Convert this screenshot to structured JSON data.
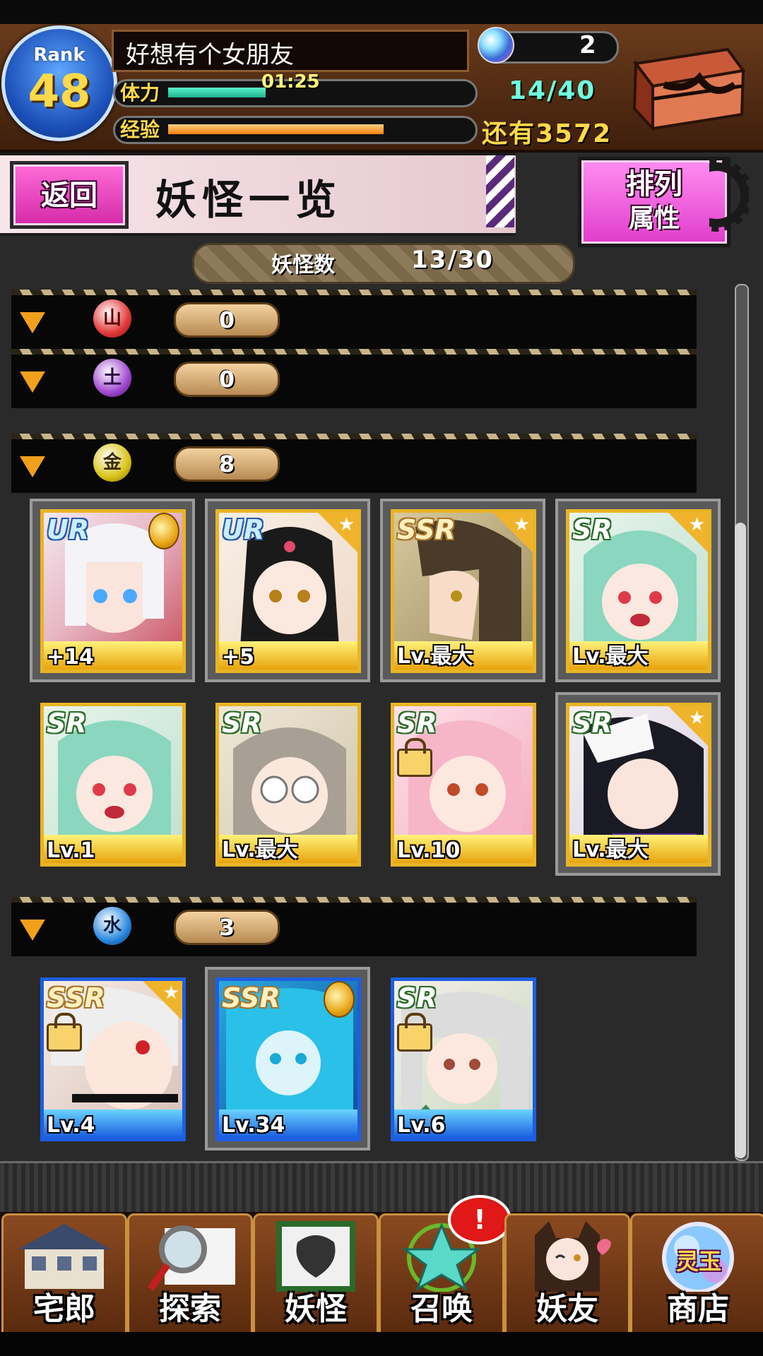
{
  "header": {
    "rank_label": "Rank",
    "rank_value": "48",
    "player_name": "好想有个女朋友",
    "stamina_label": "体力",
    "stamina_timer": "01:25",
    "stamina_progress": 0.28,
    "exp_label": "经验",
    "exp_progress": 0.62,
    "gem_count": "2",
    "stamina_count": "14/40",
    "exp_remaining": "还有3572"
  },
  "title_bar": {
    "back_label": "返回",
    "page_title": "妖怪一览",
    "sort_label": "排列",
    "sort_value": "属性"
  },
  "yokai_count": {
    "label": "妖怪数",
    "value": "13/30"
  },
  "groups": [
    {
      "element_icon": "fire-element-icon",
      "count": "0",
      "color": "#e23a3a"
    },
    {
      "element_icon": "dark-element-icon",
      "count": "0",
      "color": "#a04ad0"
    },
    {
      "element_icon": "earth-element-icon",
      "count": "8",
      "color": "#d8c418",
      "cards": [
        {
          "rarity": "UR",
          "level": "+14",
          "medal": true,
          "frame": "gold"
        },
        {
          "rarity": "UR",
          "level": "+5",
          "star": true,
          "frame": "gold"
        },
        {
          "rarity": "SSR",
          "level": "Lv.最大",
          "star": true,
          "frame": "gold"
        },
        {
          "rarity": "SR",
          "level": "Lv.最大",
          "star": true,
          "frame": "gold"
        },
        {
          "rarity": "SR",
          "level": "Lv.1",
          "frame": "gold"
        },
        {
          "rarity": "SR",
          "level": "Lv.最大",
          "frame": "gold"
        },
        {
          "rarity": "SR",
          "level": "Lv.10",
          "locked": true,
          "frame": "gold"
        },
        {
          "rarity": "SR",
          "level": "Lv.最大",
          "star": true,
          "frame": "gold"
        }
      ]
    },
    {
      "element_icon": "water-element-icon",
      "count": "3",
      "color": "#2a8ae0",
      "cards": [
        {
          "rarity": "SSR",
          "level": "Lv.4",
          "star": true,
          "locked": true,
          "frame": "blue"
        },
        {
          "rarity": "SSR",
          "level": "Lv.34",
          "medal": true,
          "frame": "blue"
        },
        {
          "rarity": "SR",
          "level": "Lv.6",
          "locked": true,
          "frame": "blue"
        }
      ]
    }
  ],
  "nav": [
    {
      "label": "宅郎",
      "icon": "house-icon"
    },
    {
      "label": "探索",
      "icon": "magnifier-map-icon"
    },
    {
      "label": "妖怪",
      "icon": "scroll-icon"
    },
    {
      "label": "召唤",
      "icon": "pentagram-icon",
      "badge": "!"
    },
    {
      "label": "妖友",
      "icon": "friend-avatar-icon"
    },
    {
      "label": "商店",
      "icon": "orb-shop-icon",
      "orb_text": "灵玉"
    }
  ],
  "colors": {
    "accent_pink": "#e03ccc",
    "gold": "#e8b426",
    "header_brown": "#6a3b1c"
  }
}
